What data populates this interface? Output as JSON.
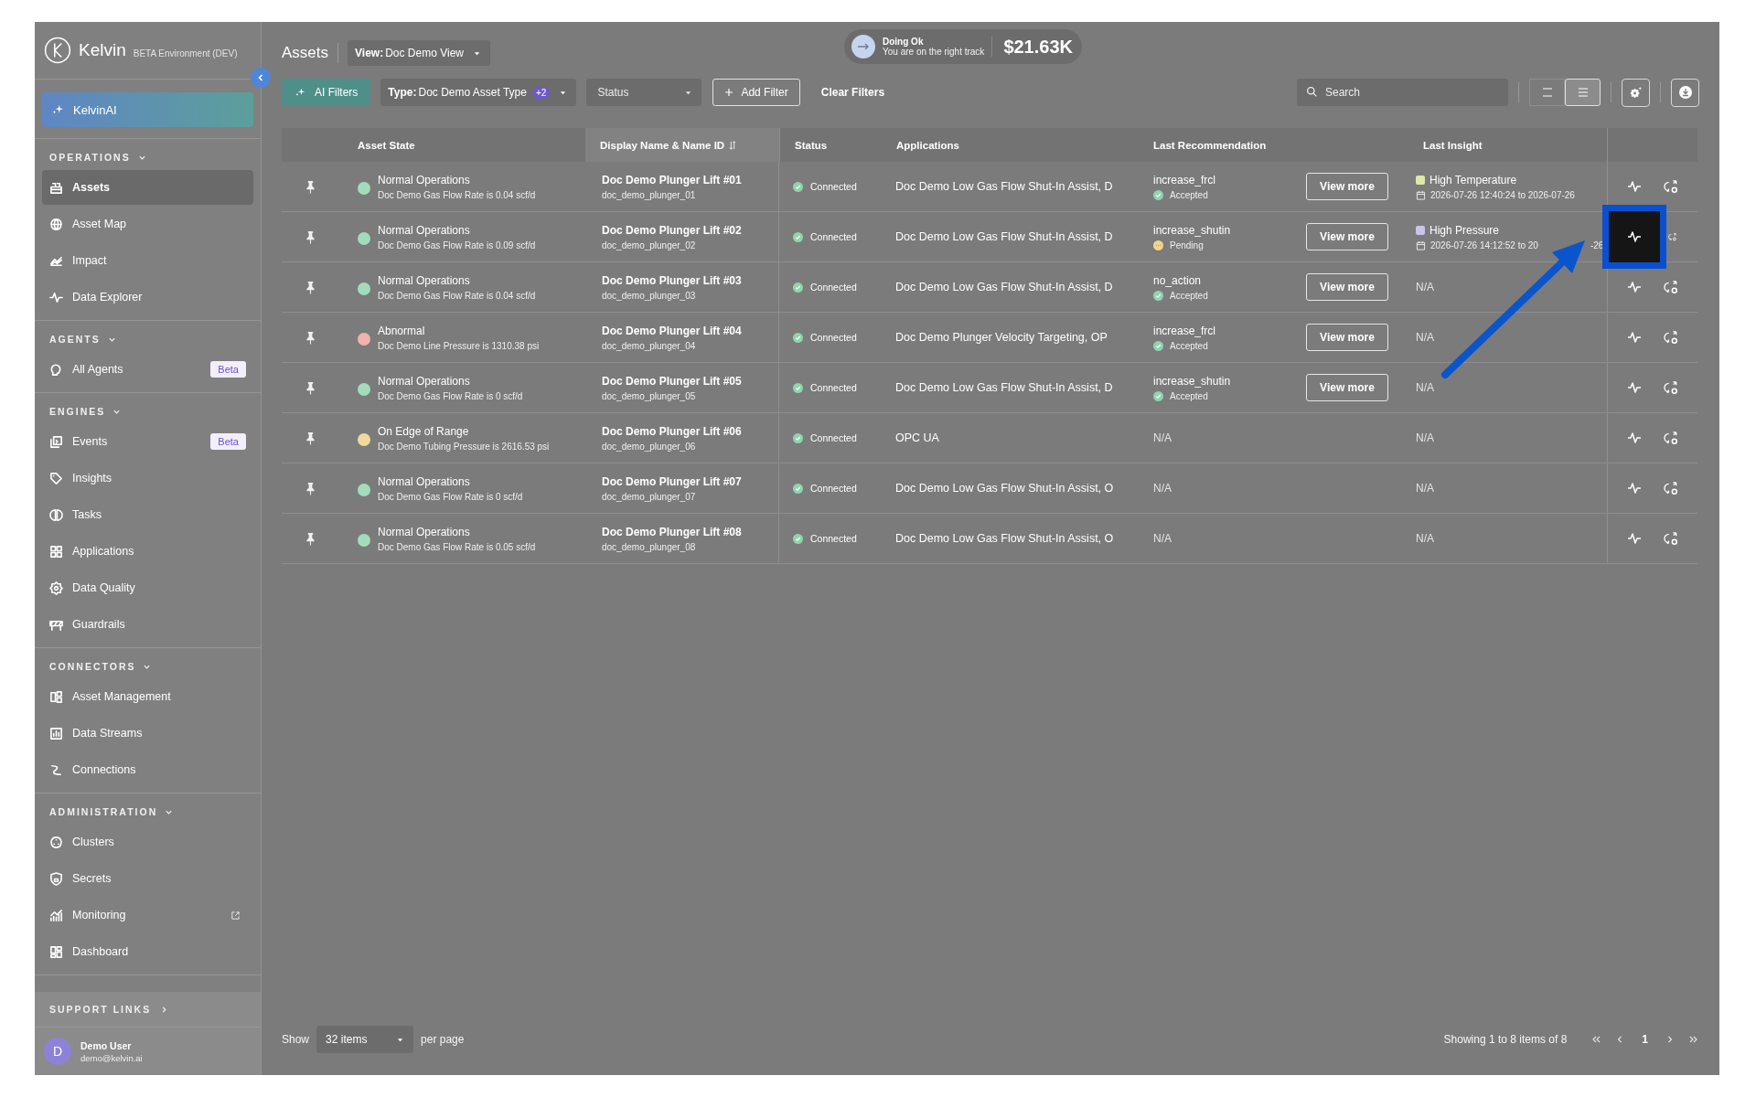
{
  "sidebar": {
    "brand": "Kelvin",
    "environment": "BETA Environment (DEV)",
    "ai_button": "KelvinAI",
    "sections": [
      {
        "title": "OPERATIONS",
        "items": [
          {
            "label": "Assets",
            "selected": true
          },
          {
            "label": "Asset Map",
            "selected": false
          },
          {
            "label": "Impact",
            "selected": false
          },
          {
            "label": "Data Explorer",
            "selected": false
          }
        ]
      },
      {
        "title": "AGENTS",
        "items": [
          {
            "label": "All Agents",
            "selected": false,
            "badge": "Beta"
          }
        ]
      },
      {
        "title": "ENGINES",
        "items": [
          {
            "label": "Events",
            "selected": false,
            "badge": "Beta"
          },
          {
            "label": "Insights",
            "selected": false
          },
          {
            "label": "Tasks",
            "selected": false
          },
          {
            "label": "Applications",
            "selected": false
          },
          {
            "label": "Data Quality",
            "selected": false
          },
          {
            "label": "Guardrails",
            "selected": false
          }
        ]
      },
      {
        "title": "CONNECTORS",
        "items": [
          {
            "label": "Asset Management",
            "selected": false
          },
          {
            "label": "Data Streams",
            "selected": false
          },
          {
            "label": "Connections",
            "selected": false
          }
        ]
      },
      {
        "title": "ADMINISTRATION",
        "items": [
          {
            "label": "Clusters",
            "selected": false
          },
          {
            "label": "Secrets",
            "selected": false
          },
          {
            "label": "Monitoring",
            "selected": false,
            "external": true
          },
          {
            "label": "Dashboard",
            "selected": false
          }
        ]
      }
    ],
    "support_links": "SUPPORT LINKS",
    "user": {
      "initial": "D",
      "name": "Demo User",
      "email": "demo@kelvin.ai"
    }
  },
  "header": {
    "title": "Assets",
    "view_label": "View:",
    "view_value": "Doc Demo View",
    "status_pill": {
      "title": "Doing Ok",
      "subtitle": "You are on the right track",
      "amount": "$21.63K"
    }
  },
  "filters": {
    "ai_filters": "AI Filters",
    "type_label": "Type:",
    "type_value": "Doc Demo Asset Type",
    "type_count": "+2",
    "status": {
      "placeholder": "Status"
    },
    "add_filter": "Add Filter",
    "clear_filters": "Clear Filters",
    "search": {
      "placeholder": "Search"
    },
    "density": [
      {
        "selected": false
      },
      {
        "selected": true
      }
    ]
  },
  "table": {
    "columns": [
      {
        "label": "Asset State",
        "sorted": false
      },
      {
        "label": "Display Name & Name ID",
        "sorted": true
      },
      {
        "label": "Status",
        "sorted": false
      },
      {
        "label": "Applications",
        "sorted": false
      },
      {
        "label": "Last Recommendation",
        "sorted": false
      },
      {
        "label": "Last Insight",
        "sorted": false
      }
    ],
    "rows": [
      {
        "state": "Normal Operations",
        "state_detail": "Doc Demo Gas Flow Rate is 0.04 scf/d",
        "color": "#a3dcbd",
        "name": "Doc Demo Plunger Lift #01",
        "name_id": "doc_demo_plunger_01",
        "status": "Connected",
        "applications": "Doc Demo Low Gas Flow Shut-In Assist, D",
        "recommendation": {
          "kind": "accepted",
          "action": "increase_frcl",
          "status": "Accepted",
          "button": "View more"
        },
        "insight": {
          "kind": "event",
          "label": "High Temperature",
          "color": "#dde9a8",
          "range": [
            "2026-07-26 12:40:24 to 2026-07-26"
          ]
        },
        "highlighted": false
      },
      {
        "state": "Normal Operations",
        "state_detail": "Doc Demo Gas Flow Rate is 0.09 scf/d",
        "color": "#a3dcbd",
        "name": "Doc Demo Plunger Lift #02",
        "name_id": "doc_demo_plunger_02",
        "status": "Connected",
        "applications": "Doc Demo Low Gas Flow Shut-In Assist, D",
        "recommendation": {
          "kind": "pending",
          "action": "increase_shutin",
          "status": "Pending",
          "button": "View more"
        },
        "insight": {
          "kind": "event",
          "label": "High Pressure",
          "color": "#cbc3ea",
          "range": [
            "2026-07-26 14:12:52 to 20",
            "-26"
          ]
        },
        "highlighted": true
      },
      {
        "state": "Normal Operations",
        "state_detail": "Doc Demo Gas Flow Rate is 0.04 scf/d",
        "color": "#a3dcbd",
        "name": "Doc Demo Plunger Lift #03",
        "name_id": "doc_demo_plunger_03",
        "status": "Connected",
        "applications": "Doc Demo Low Gas Flow Shut-In Assist, D",
        "recommendation": {
          "kind": "accepted",
          "action": "no_action",
          "status": "Accepted",
          "button": "View more"
        },
        "insight": {
          "kind": "none",
          "text": "N/A"
        },
        "highlighted": false
      },
      {
        "state": "Abnormal",
        "state_detail": "Doc Demo Line Pressure is 1310.38 psi",
        "color": "#f0b3ad",
        "name": "Doc Demo Plunger Lift #04",
        "name_id": "doc_demo_plunger_04",
        "status": "Connected",
        "applications": "Doc Demo Plunger Velocity Targeting, OP",
        "recommendation": {
          "kind": "accepted",
          "action": "increase_frcl",
          "status": "Accepted",
          "button": "View more"
        },
        "insight": {
          "kind": "none",
          "text": "N/A"
        },
        "highlighted": false
      },
      {
        "state": "Normal Operations",
        "state_detail": "Doc Demo Gas Flow Rate is 0 scf/d",
        "color": "#a3dcbd",
        "name": "Doc Demo Plunger Lift #05",
        "name_id": "doc_demo_plunger_05",
        "status": "Connected",
        "applications": "Doc Demo Low Gas Flow Shut-In Assist, D",
        "recommendation": {
          "kind": "accepted",
          "action": "increase_shutin",
          "status": "Accepted",
          "button": "View more"
        },
        "insight": {
          "kind": "none",
          "text": "N/A"
        },
        "highlighted": false
      },
      {
        "state": "On Edge of Range",
        "state_detail": "Doc Demo Tubing Pressure is 2616.53 psi",
        "color": "#f2da9c",
        "name": "Doc Demo Plunger Lift #06",
        "name_id": "doc_demo_plunger_06",
        "status": "Connected",
        "applications": "OPC UA",
        "recommendation": {
          "kind": "none",
          "text": "N/A"
        },
        "insight": {
          "kind": "none",
          "text": "N/A"
        },
        "highlighted": false
      },
      {
        "state": "Normal Operations",
        "state_detail": "Doc Demo Gas Flow Rate is 0 scf/d",
        "color": "#a3dcbd",
        "name": "Doc Demo Plunger Lift #07",
        "name_id": "doc_demo_plunger_07",
        "status": "Connected",
        "applications": "Doc Demo Low Gas Flow Shut-In Assist, O",
        "recommendation": {
          "kind": "none",
          "text": "N/A"
        },
        "insight": {
          "kind": "none",
          "text": "N/A"
        },
        "highlighted": false
      },
      {
        "state": "Normal Operations",
        "state_detail": "Doc Demo Gas Flow Rate is 0.05 scf/d",
        "color": "#a3dcbd",
        "name": "Doc Demo Plunger Lift #08",
        "name_id": "doc_demo_plunger_08",
        "status": "Connected",
        "applications": "Doc Demo Low Gas Flow Shut-In Assist, O",
        "recommendation": {
          "kind": "none",
          "text": "N/A"
        },
        "insight": {
          "kind": "none",
          "text": "N/A"
        },
        "highlighted": false
      }
    ]
  },
  "footer": {
    "show": "Show",
    "page_size": "32 items",
    "per_page": "per page",
    "summary": "Showing 1 to 8 items of 8",
    "pages": [
      {
        "label": "1",
        "selected": true
      }
    ]
  }
}
